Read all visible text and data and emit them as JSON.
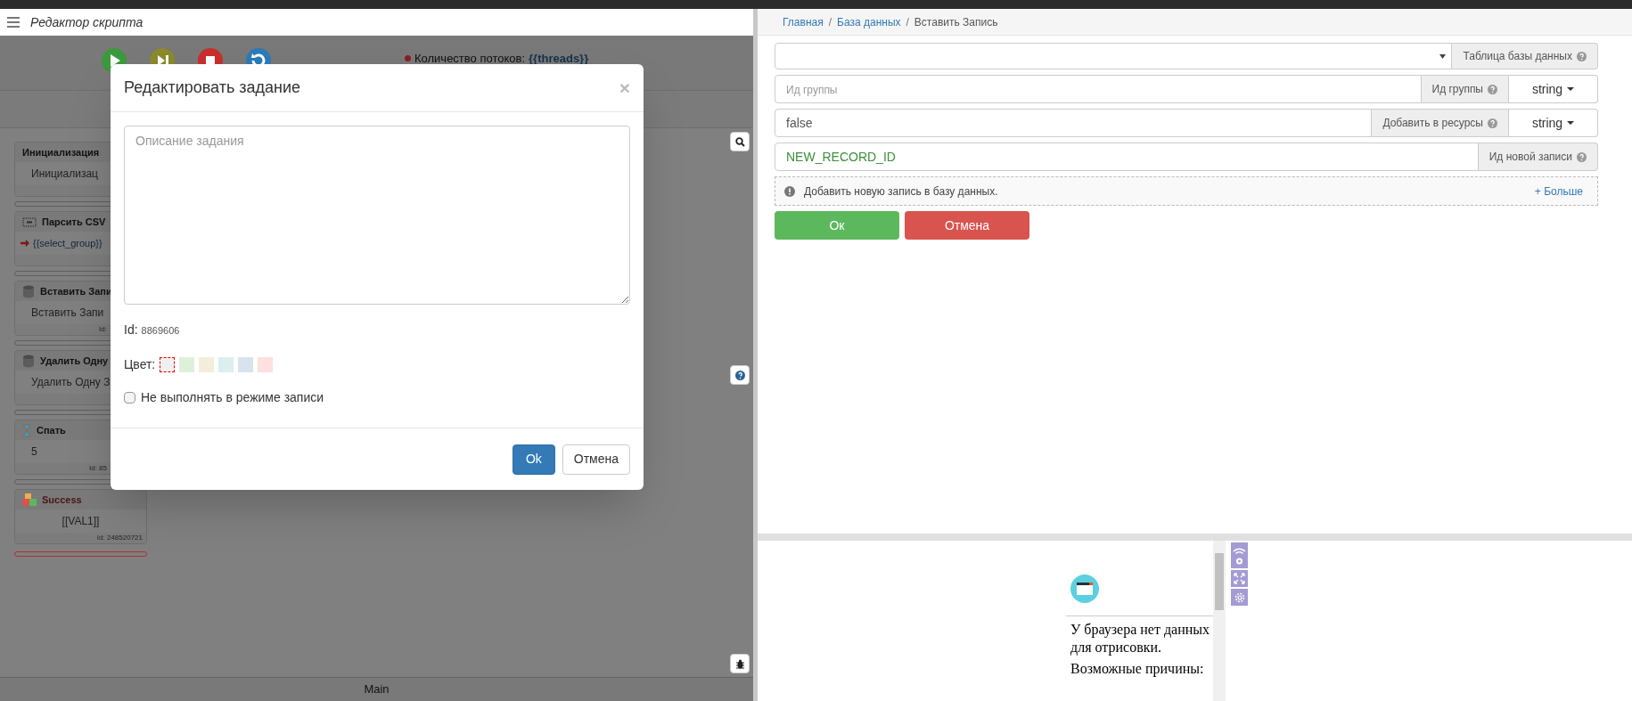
{
  "editor": {
    "title": "Редактор скрипта",
    "threads_label": "Количество потоков:",
    "threads_value": "{{threads}}",
    "blocks": [
      {
        "kind": "init",
        "title": "Инициализация",
        "body": "Инициализац"
      },
      {
        "kind": "csv",
        "title": "Парсить CSV",
        "body": "{{select_group}}"
      },
      {
        "kind": "db",
        "title": "Вставить Запи",
        "body": "Вставить Запи",
        "id": "Id:"
      },
      {
        "kind": "db",
        "title": "Удалить Одну",
        "body": "Удалить Одну З"
      },
      {
        "kind": "sleep",
        "title": "Спать",
        "body": "5",
        "id": "Id: 85"
      },
      {
        "kind": "success",
        "title": "Success",
        "body": "[[VAL1]]",
        "id": "Id: 248520721"
      }
    ],
    "tab": {
      "label": "Main",
      "selected": true
    }
  },
  "dialog": {
    "title": "Редактировать задание",
    "close": "×",
    "placeholder": "Описание задания",
    "id_label": "Id:",
    "id_value": "8869606",
    "color_label": "Цвет:",
    "colors": [
      {
        "color": "#f0f0f0",
        "selected": true
      },
      {
        "color": "#dff0d8",
        "selected": false
      },
      {
        "color": "#f2eedb",
        "selected": false
      },
      {
        "color": "#d9f0ef",
        "selected": false
      },
      {
        "color": "#d9e3ee",
        "selected": false
      },
      {
        "color": "#fde0e0",
        "selected": false
      }
    ],
    "checkbox": {
      "label": "Не выполнять в режиме записи",
      "checked": false
    },
    "buttons": [
      {
        "kind": "primary",
        "label": "Ok"
      },
      {
        "kind": "default",
        "label": "Отмена"
      }
    ]
  },
  "breadcrumb": [
    {
      "label": "Главная",
      "current": false
    },
    {
      "separator": "/",
      "label": "База данных",
      "current": false
    },
    {
      "separator": "/",
      "label": "Вставить Запись",
      "current": true
    }
  ],
  "form": {
    "rows": [
      {
        "kind": "select",
        "addon": "Таблица базы данных"
      },
      {
        "kind": "input",
        "placeholder": "Ид группы",
        "addon": "Ид группы",
        "type": "string"
      },
      {
        "kind": "input",
        "value": "false",
        "addon": "Добавить в ресурсы",
        "type": "string"
      },
      {
        "kind": "variable",
        "value": "NEW_RECORD_ID",
        "addon": "Ид новой записи"
      }
    ],
    "info": "Добавить новую запись в базу данных.",
    "more": "+ Больше",
    "buttons": [
      {
        "kind": "ok",
        "label": "Ок"
      },
      {
        "kind": "cancel",
        "label": "Отмена"
      }
    ]
  },
  "browser": {
    "lines": [
      "У браузера нет данных для отрисовки.",
      "Возможные причины:"
    ]
  }
}
